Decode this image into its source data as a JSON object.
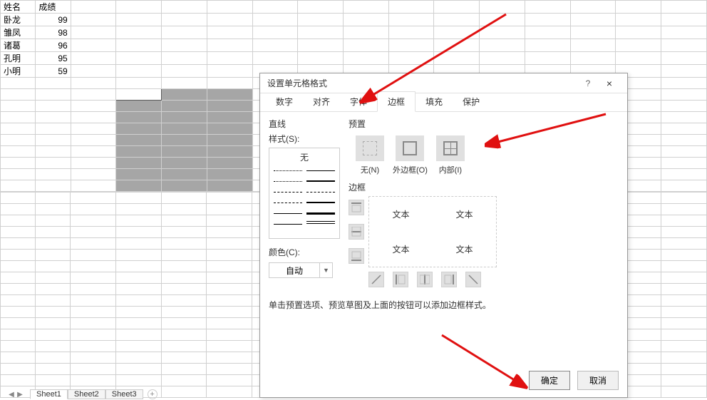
{
  "table": {
    "headers": [
      "姓名",
      "成绩"
    ],
    "rows": [
      {
        "name": "卧龙",
        "score": 99
      },
      {
        "name": "雏凤",
        "score": 98
      },
      {
        "name": "诸葛",
        "score": 96
      },
      {
        "name": "孔明",
        "score": 95
      },
      {
        "name": "小明",
        "score": 59
      }
    ]
  },
  "sheets": {
    "tabs": [
      "Sheet1",
      "Sheet2",
      "Sheet3"
    ]
  },
  "dialog": {
    "title": "设置单元格格式",
    "help": "?",
    "close": "×",
    "tabs": [
      "数字",
      "对齐",
      "字体",
      "边框",
      "填充",
      "保护"
    ],
    "line_section": "直线",
    "style_label": "样式(S):",
    "style_none": "无",
    "color_label": "颜色(C):",
    "color_value": "自动",
    "presets_label": "预置",
    "presets": [
      {
        "label": "无(N)"
      },
      {
        "label": "外边框(O)"
      },
      {
        "label": "内部(I)"
      }
    ],
    "border_label": "边框",
    "preview_text": "文本",
    "hint": "单击预置选项、预览草图及上面的按钮可以添加边框样式。",
    "ok": "确定",
    "cancel": "取消"
  }
}
